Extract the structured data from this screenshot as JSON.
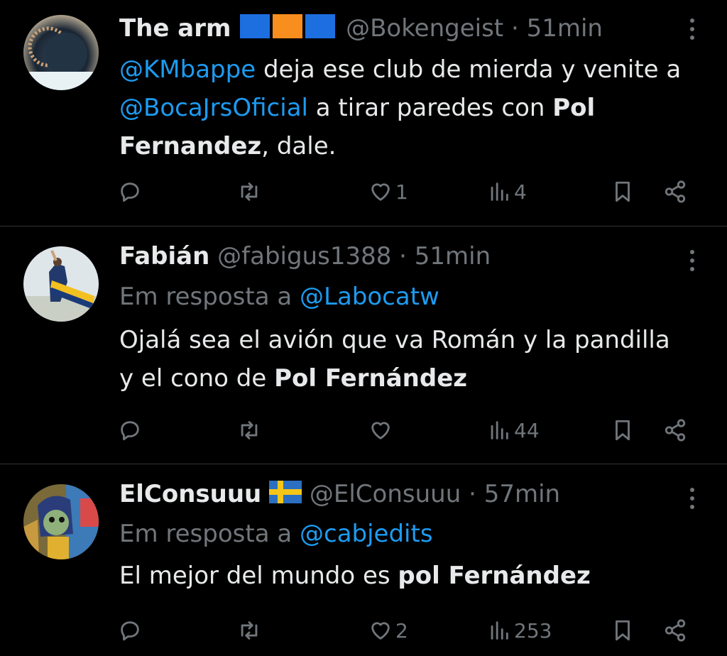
{
  "tweets": [
    {
      "name": "The arm",
      "handle": "@Bokengeist",
      "dot": "·",
      "time": "51min",
      "text_parts": {
        "m1": "@KMbappe",
        "t1": " deja ese club de mierda y venite a ",
        "m2": "@BocaJrsOficial",
        "t2": " a tirar paredes con ",
        "b1": "Pol Fernandez",
        "t3": ", dale."
      },
      "stats": {
        "likes": "1",
        "views": "4"
      },
      "flag_colors": [
        "#1d6fe0",
        "#f78e1e",
        "#1d6fe0"
      ]
    },
    {
      "name": "Fabián",
      "handle": "@fabigus1388",
      "dot": "·",
      "time": "51min",
      "reply_label": "Em resposta a ",
      "reply_to": "@Labocatw",
      "text_parts": {
        "t1": "Ojalá sea el avión que va Román y la pandilla y el cono de ",
        "b1": "Pol Fernández"
      },
      "stats": {
        "likes": "",
        "views": "44"
      }
    },
    {
      "name": "ElConsuuu",
      "handle": "@ElConsuuu",
      "dot": "·",
      "time": "57min",
      "reply_label": "Em resposta a ",
      "reply_to": "@cabjedits",
      "text_parts": {
        "t1": "El mejor del mundo es ",
        "b1": "pol Fernández"
      },
      "stats": {
        "likes": "2",
        "views": "253"
      }
    }
  ],
  "icons": [
    "reply-icon",
    "retweet-icon",
    "like-icon",
    "views-icon",
    "bookmark-icon",
    "share-icon",
    "more-icon"
  ],
  "colors": {
    "background": "#000000",
    "text": "#e7e9ea",
    "muted": "#71767b",
    "link": "#1d9bf0",
    "divider": "#2f3336"
  }
}
